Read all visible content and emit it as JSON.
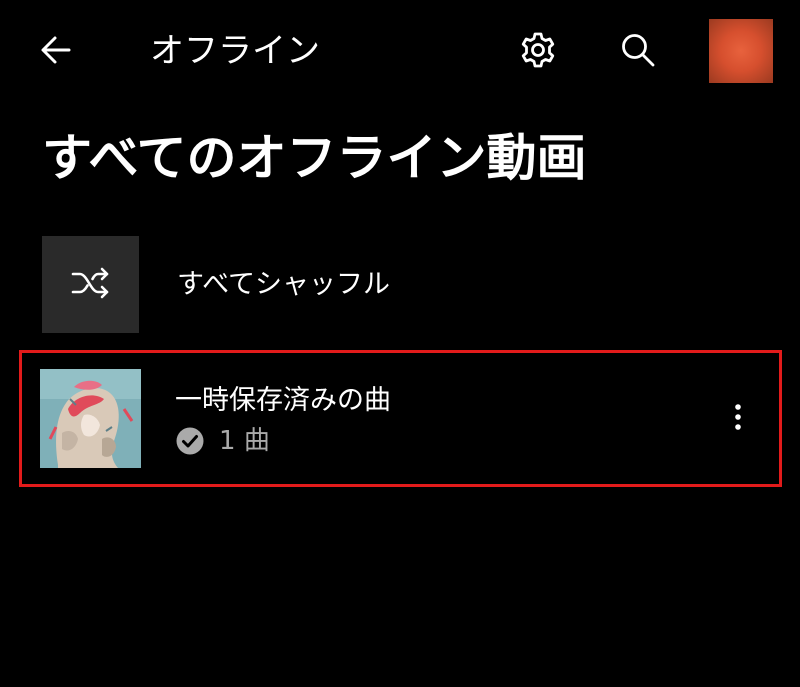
{
  "app_bar": {
    "title": "オフライン",
    "back_icon": "arrow-left-icon",
    "settings_icon": "gear-icon",
    "search_icon": "search-icon",
    "avatar_color": "#d64f2e"
  },
  "page": {
    "title": "すべてのオフライン動画"
  },
  "shuffle": {
    "label": "すべてシャッフル",
    "icon": "shuffle-icon"
  },
  "playlists": [
    {
      "name": "一時保存済みの曲",
      "status_icon": "check-circle-icon",
      "count_number": "1",
      "count_unit": "曲",
      "menu_icon": "more-vert-icon"
    }
  ],
  "colors": {
    "background": "#000000",
    "text_primary": "#ffffff",
    "text_secondary": "#aaaaaa",
    "tile": "#2a2a2a",
    "highlight": "#e21b1b"
  }
}
